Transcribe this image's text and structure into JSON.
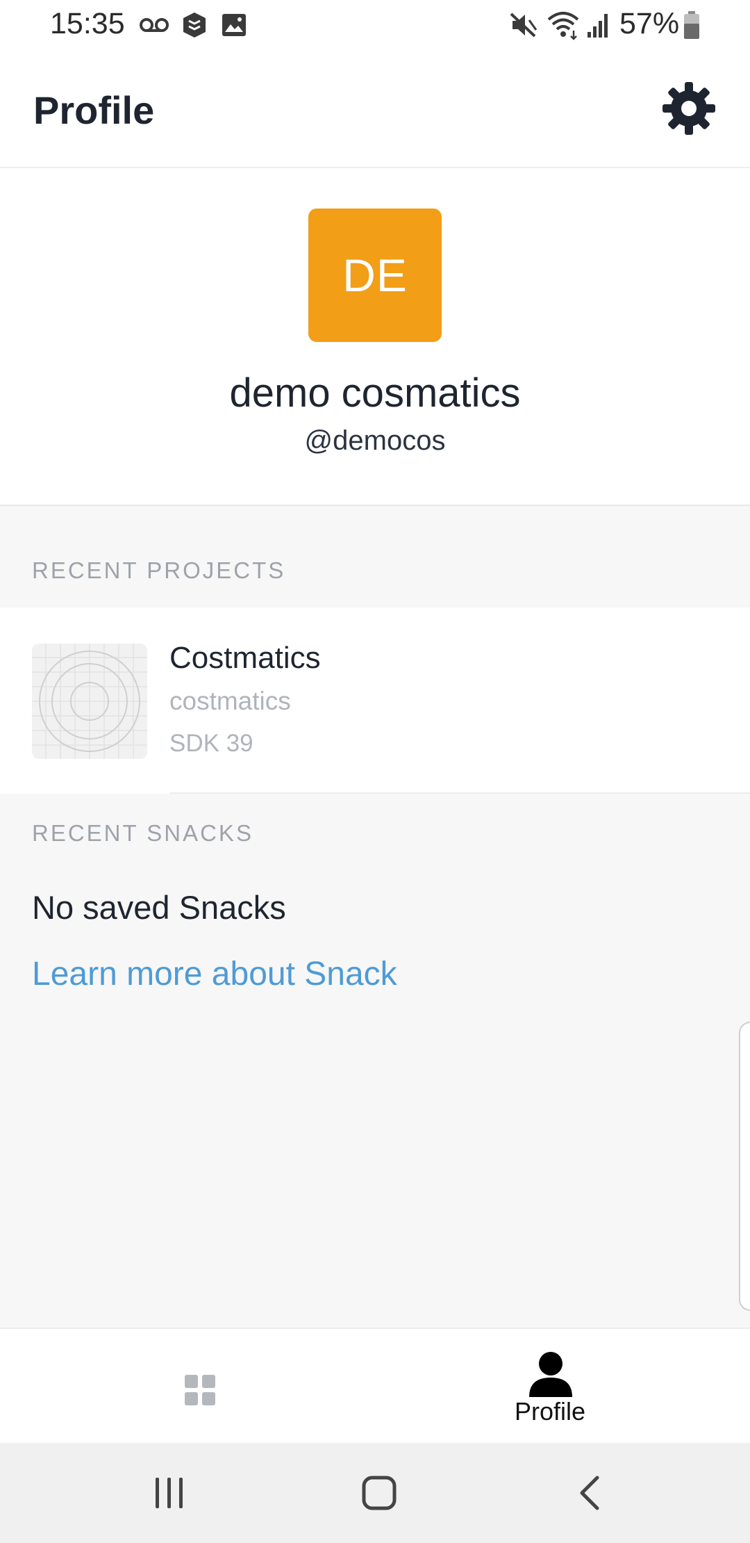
{
  "status_bar": {
    "time": "15:35",
    "battery": "57%",
    "icons": [
      "voicemail-icon",
      "expo-icon",
      "image-icon",
      "mute-icon",
      "wifi-icon",
      "signal-icon",
      "battery-icon"
    ]
  },
  "header": {
    "title": "Profile",
    "settings_icon": "gear-icon"
  },
  "profile": {
    "initials": "DE",
    "name": "demo cosmatics",
    "username": "@democos",
    "avatar_color": "#f29e17"
  },
  "recent_projects": {
    "heading": "RECENT PROJECTS",
    "items": [
      {
        "name": "Costmatics",
        "slug": "costmatics",
        "sdk": "SDK 39"
      }
    ]
  },
  "recent_snacks": {
    "heading": "RECENT SNACKS",
    "empty_text": "No saved Snacks",
    "learn_more": "Learn more about Snack"
  },
  "tab_bar": {
    "tabs": [
      {
        "icon": "grid-icon",
        "label": "",
        "active": false
      },
      {
        "icon": "person-icon",
        "label": "Profile",
        "active": true
      }
    ]
  },
  "nav_bar": {
    "buttons": [
      "recent-apps-icon",
      "home-icon",
      "back-icon"
    ]
  },
  "colors": {
    "accent_link": "#4e9bd6",
    "text_primary": "#1f2530",
    "text_muted": "#9ea3aa"
  }
}
